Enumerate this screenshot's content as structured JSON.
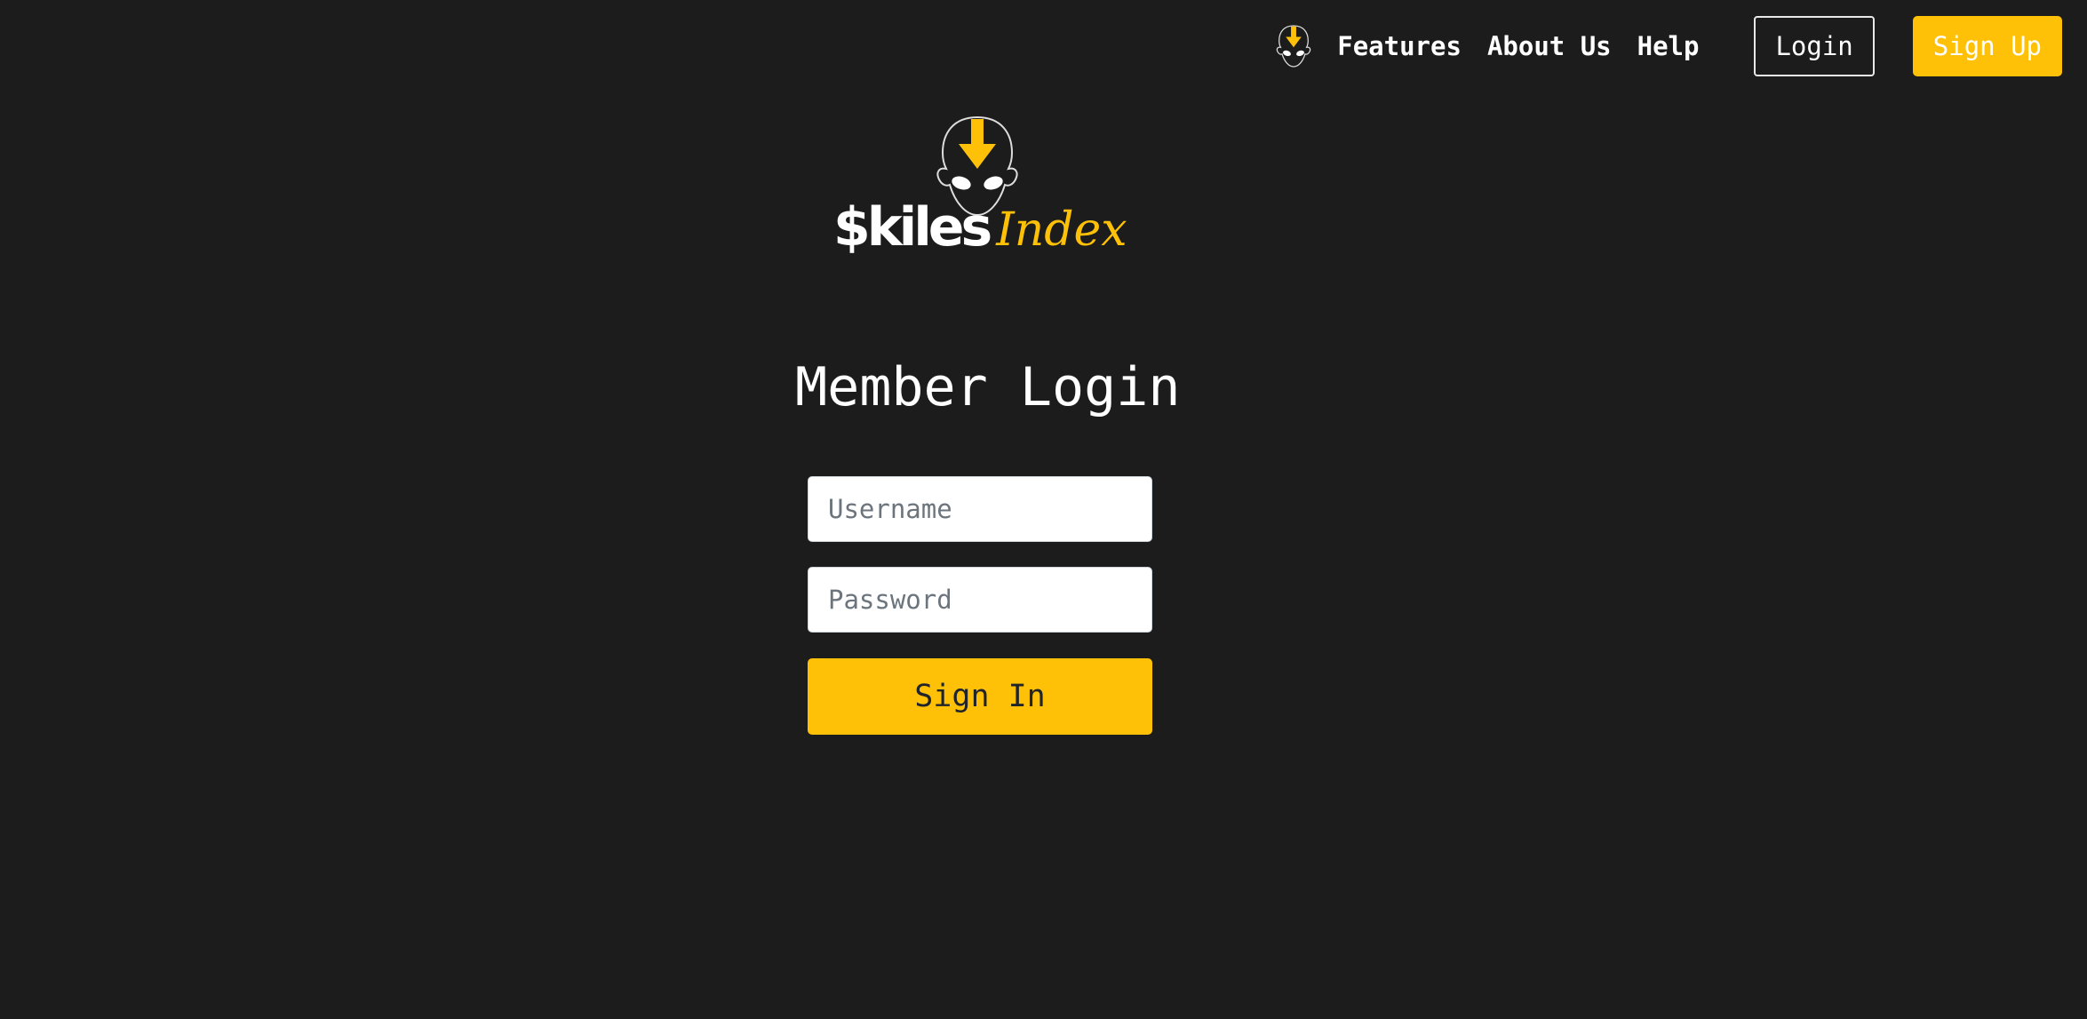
{
  "nav": {
    "links": [
      {
        "label": "Features"
      },
      {
        "label": "About Us"
      },
      {
        "label": "Help"
      }
    ],
    "login_label": "Login",
    "signup_label": "Sign Up"
  },
  "brand": {
    "word_main": "$kiles",
    "word_accent": "Index"
  },
  "login": {
    "title": "Member Login",
    "username_placeholder": "Username",
    "password_placeholder": "Password",
    "submit_label": "Sign In"
  },
  "colors": {
    "background": "#1c1c1c",
    "accent": "#ffc107",
    "text": "#ffffff"
  },
  "icons": {
    "nav_logo": "avatar-head-arrow-icon",
    "brand_logo": "avatar-head-arrow-icon"
  }
}
